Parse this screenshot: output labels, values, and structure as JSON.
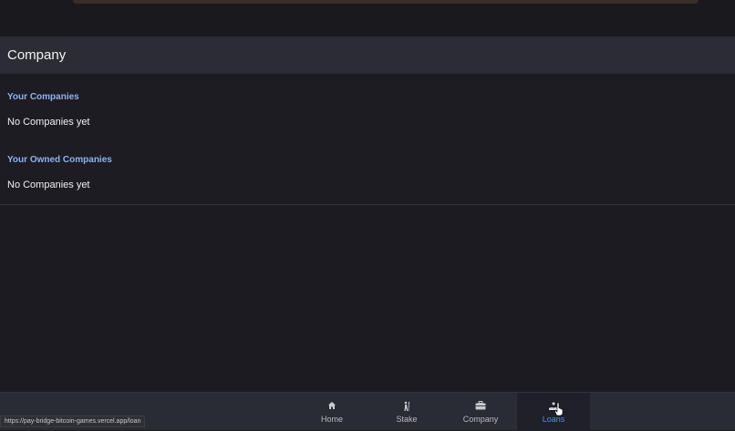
{
  "header": {
    "title": "Company"
  },
  "sections": [
    {
      "title": "Your Companies",
      "empty_text": "No Companies yet"
    },
    {
      "title": "Your Owned Companies",
      "empty_text": "No Companies yet"
    }
  ],
  "bottom_nav": {
    "items": [
      {
        "label": "Home",
        "icon": "home-icon"
      },
      {
        "label": "Stake",
        "icon": "stake-icon"
      },
      {
        "label": "Company",
        "icon": "briefcase-icon"
      },
      {
        "label": "Loans",
        "icon": "loans-icon",
        "active": true
      }
    ]
  },
  "status_bar": {
    "url": "https://pay-bridge-bitcoin-games.vercel.app/loan"
  },
  "colors": {
    "accent": "#4f8ff0",
    "section_title": "#8fb2f0",
    "background": "#1c1b21",
    "header_bg": "#2b2c34"
  }
}
